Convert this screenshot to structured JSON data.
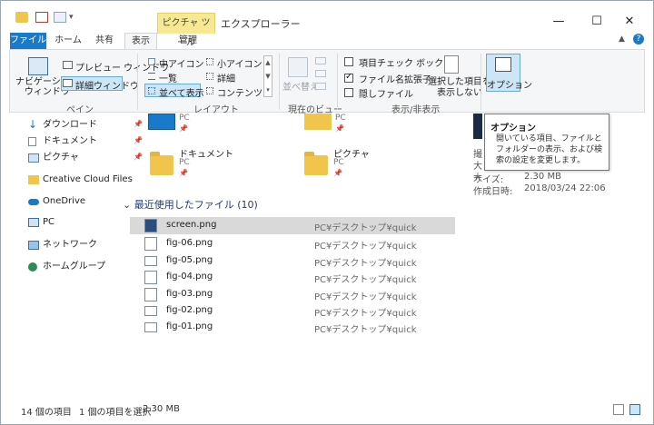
{
  "window": {
    "title": "エクスプローラー",
    "context_tab": "ピクチャ ツール",
    "buttons": {
      "minimize": "—",
      "maximize": "☐",
      "close": "✕"
    }
  },
  "ribbon_tabs": [
    "ファイル",
    "ホーム",
    "共有",
    "表示",
    "管理"
  ],
  "ribbon": {
    "pane": {
      "navigation_pane": "ナビゲーション\nウィンドウ",
      "preview_pane": "プレビュー ウィンドウ",
      "details_pane": "詳細ウィンドウ",
      "group": "ペイン"
    },
    "layout": {
      "items": [
        "中アイコン",
        "小アイコン",
        "一覧",
        "詳細",
        "並べて表示",
        "コンテンツ"
      ],
      "group": "レイアウト"
    },
    "current_view": {
      "sort": "並べ替え",
      "group": "現在のビュー"
    },
    "show_hide": {
      "item_checkboxes": "項目チェック ボックス",
      "file_extensions": "ファイル名拡張子",
      "hidden_items": "隠しファイル",
      "hide_selected": "選択した項目を\n表示しない",
      "group": "表示/非表示",
      "checks": {
        "item_checkboxes": false,
        "file_extensions": true,
        "hidden_items": false
      }
    },
    "options": "オプション"
  },
  "nav_pane": {
    "items": [
      "ダウンロード",
      "ドキュメント",
      "ピクチャ",
      "Creative Cloud Files",
      "OneDrive",
      "PC",
      "ネットワーク",
      "ホームグループ"
    ]
  },
  "quick_access": {
    "folders": [
      {
        "name": "",
        "sub": "PC"
      },
      {
        "name": "",
        "sub": "PC"
      },
      {
        "name": "ドキュメント",
        "sub": "PC"
      },
      {
        "name": "ピクチャ",
        "sub": "PC"
      }
    ]
  },
  "recent": {
    "heading": "最近使用したファイル (10)",
    "files": [
      {
        "name": "screen.png",
        "path": "PC¥デスクトップ¥quick",
        "selected": true
      },
      {
        "name": "fig-06.png",
        "path": "PC¥デスクトップ¥quick",
        "selected": false
      },
      {
        "name": "fig-05.png",
        "path": "PC¥デスクトップ¥quick",
        "selected": false
      },
      {
        "name": "fig-04.png",
        "path": "PC¥デスクトップ¥quick",
        "selected": false
      },
      {
        "name": "fig-03.png",
        "path": "PC¥デスクトップ¥quick",
        "selected": false
      },
      {
        "name": "fig-02.png",
        "path": "PC¥デスクトップ¥quick",
        "selected": false
      },
      {
        "name": "fig-01.png",
        "path": "PC¥デスクトップ¥quick",
        "selected": false
      }
    ]
  },
  "preview": {
    "rows": [
      "撮",
      "大",
      "大",
      "サイズ:",
      "作成日時:"
    ],
    "values": [
      "",
      "",
      "",
      "2.30 MB",
      "2018/03/24 22:06"
    ]
  },
  "tooltip": {
    "title": "オプション",
    "body": "開いている項目、ファイルとフォルダーの表示、および検索の設定を変更します。"
  },
  "status": {
    "items_count": "14 個の項目",
    "selected": "1 個の項目を選択",
    "size": "2.30 MB"
  },
  "colors": {
    "accent": "#1979ca",
    "context_tab": "#f7e993",
    "selection": "#d9d9d9"
  }
}
